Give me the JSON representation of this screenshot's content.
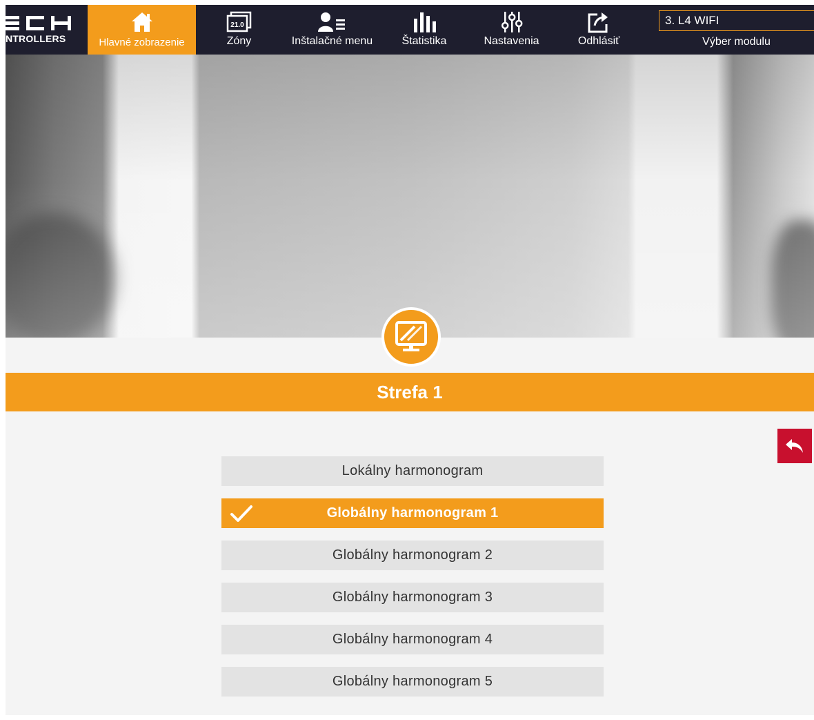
{
  "logo": {
    "text": "NTROLLERS"
  },
  "nav": {
    "items": [
      {
        "label": "Hlavné zobrazenie",
        "icon": "home-icon",
        "active": true
      },
      {
        "label": "Zóny",
        "icon": "zones-icon",
        "icon_text": "21.0"
      },
      {
        "label": "Inštalačné menu",
        "icon": "user-menu-icon"
      },
      {
        "label": "Štatistika",
        "icon": "bar-chart-icon"
      },
      {
        "label": "Nastavenia",
        "icon": "sliders-icon"
      },
      {
        "label": "Odhlásiť",
        "icon": "logout-icon"
      }
    ]
  },
  "module": {
    "value": "3. L4 WIFI",
    "label": "Výber modulu"
  },
  "zone": {
    "title": "Strefa 1",
    "icon": "screen-icon"
  },
  "back_button": {
    "icon": "back-arrow-icon"
  },
  "schedules": [
    {
      "label": "Lokálny harmonogram",
      "selected": false
    },
    {
      "label": "Globálny harmonogram 1",
      "selected": true
    },
    {
      "label": "Globálny harmonogram 2",
      "selected": false
    },
    {
      "label": "Globálny harmonogram 3",
      "selected": false
    },
    {
      "label": "Globálny harmonogram 4",
      "selected": false
    },
    {
      "label": "Globálny harmonogram 5",
      "selected": false
    }
  ],
  "colors": {
    "accent": "#f39c1c",
    "navbar": "#1e1e2e",
    "back_button": "#c8102e",
    "option_bg": "#e3e3e3"
  }
}
